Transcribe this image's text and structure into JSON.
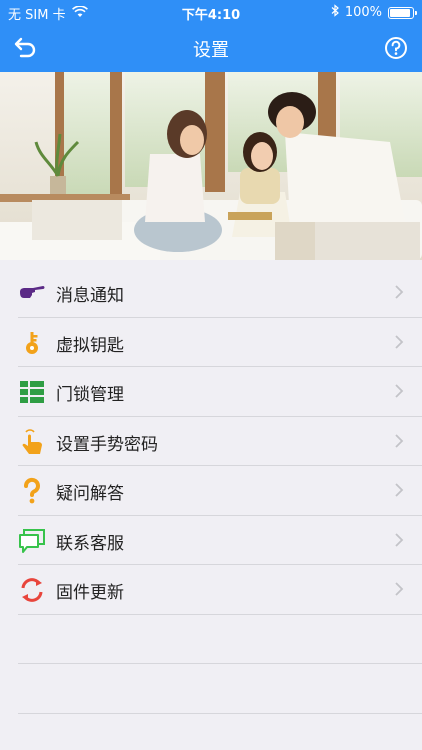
{
  "status": {
    "carrier": "无 SIM 卡",
    "time": "下午4:10",
    "battery": "100%"
  },
  "nav": {
    "title": "设置"
  },
  "menu": {
    "items": [
      {
        "label": "消息通知",
        "icon": "pointing-hand-icon",
        "color": "#5b2a86"
      },
      {
        "label": "虚拟钥匙",
        "icon": "key-icon",
        "color": "#f2a21a"
      },
      {
        "label": "门锁管理",
        "icon": "list-grid-icon",
        "color": "#2f9e44"
      },
      {
        "label": "设置手势密码",
        "icon": "gesture-touch-icon",
        "color": "#f2a21a"
      },
      {
        "label": "疑问解答",
        "icon": "question-mark-icon",
        "color": "#f2a21a"
      },
      {
        "label": "联系客服",
        "icon": "chat-bubble-icon",
        "color": "#37c34b"
      },
      {
        "label": "固件更新",
        "icon": "refresh-icon",
        "color": "#e8453c"
      }
    ]
  },
  "colors": {
    "primary": "#2f8ff7",
    "background": "#f0eff4",
    "divider": "#d6d6db"
  }
}
